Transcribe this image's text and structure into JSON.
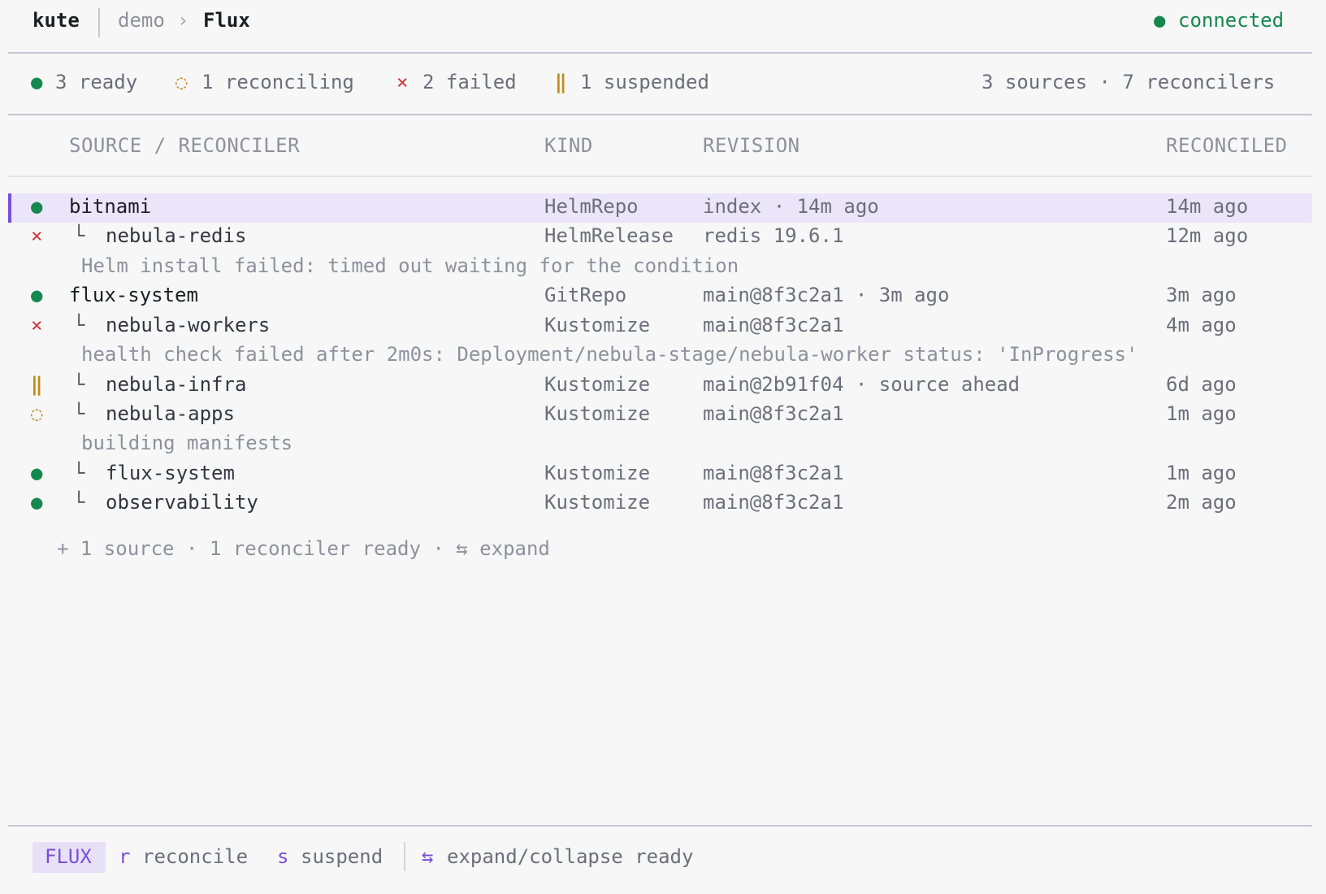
{
  "header": {
    "app": "kute",
    "breadcrumb": [
      "demo",
      "Flux"
    ],
    "breadcrumb_sep": "›",
    "status_dot": "●",
    "status": "connected"
  },
  "summary": {
    "ready": {
      "icon": "●",
      "text": "3 ready"
    },
    "reconciling": {
      "icon": "◌",
      "text": "1 reconciling"
    },
    "failed": {
      "icon": "×",
      "text": "2 failed"
    },
    "suspended": {
      "icon": "‖",
      "text": "1 suspended"
    },
    "totals": "3 sources · 7 reconcilers"
  },
  "columns": {
    "name": "SOURCE / RECONCILER",
    "kind": "KIND",
    "revision": "REVISION",
    "reconciled": "RECONCILED"
  },
  "rows": [
    {
      "icon": "●",
      "name": "bitnami",
      "kind": "HelmRepo",
      "revision": "index · 14m ago",
      "reconciled": "14m ago"
    },
    {
      "icon": "×",
      "tree": "└",
      "name": "nebula-redis",
      "kind": "HelmRelease",
      "revision": "redis 19.6.1",
      "reconciled": "12m ago",
      "message": "Helm install failed: timed out waiting for the condition"
    },
    {
      "icon": "●",
      "name": "flux-system",
      "kind": "GitRepo",
      "revision": "main@8f3c2a1 · 3m ago",
      "reconciled": "3m ago"
    },
    {
      "icon": "×",
      "tree": "└",
      "name": "nebula-workers",
      "kind": "Kustomize",
      "revision": "main@8f3c2a1",
      "reconciled": "4m ago",
      "message": "health check failed after 2m0s: Deployment/nebula-stage/nebula-worker status: 'InProgress'"
    },
    {
      "icon": "‖",
      "tree": "└",
      "name": "nebula-infra",
      "kind": "Kustomize",
      "revision": "main@2b91f04 · source ahead",
      "reconciled": "6d ago"
    },
    {
      "icon": "◌",
      "tree": "└",
      "name": "nebula-apps",
      "kind": "Kustomize",
      "revision": "main@8f3c2a1",
      "reconciled": "1m ago",
      "message": "building manifests"
    },
    {
      "icon": "●",
      "tree": "└",
      "name": "flux-system",
      "kind": "Kustomize",
      "revision": "main@8f3c2a1",
      "reconciled": "1m ago"
    },
    {
      "icon": "●",
      "tree": "└",
      "name": "observability",
      "kind": "Kustomize",
      "revision": "main@8f3c2a1",
      "reconciled": "2m ago"
    }
  ],
  "more": "+ 1 source · 1 reconciler ready · ⇆ expand",
  "footer": {
    "mode": "FLUX",
    "reconcile_key": "r",
    "reconcile_label": "reconcile",
    "suspend_key": "s",
    "suspend_label": "suspend",
    "expand_key": "⇆",
    "expand_label": "expand/collapse ready"
  },
  "colors": {
    "ready": "#16884f",
    "failed": "#d0393e",
    "warning": "#c28a1a",
    "accent": "#7a4fd6",
    "selected_row": "#ebe5fa"
  }
}
